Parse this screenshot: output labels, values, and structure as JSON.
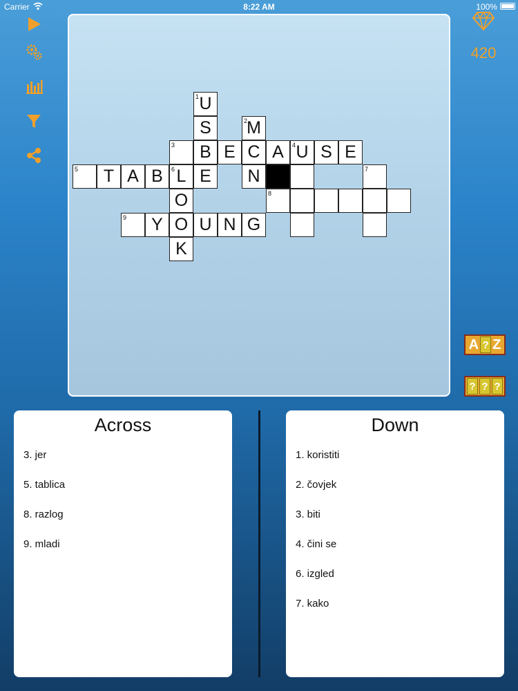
{
  "status_bar": {
    "carrier": "Carrier",
    "time": "8:22 AM",
    "battery": "100%"
  },
  "toolbar": {
    "items": [
      {
        "name": "play",
        "icon": "play-icon"
      },
      {
        "name": "settings",
        "icon": "gears-icon"
      },
      {
        "name": "statistics",
        "icon": "bar-chart-icon"
      },
      {
        "name": "filter",
        "icon": "filter-icon"
      },
      {
        "name": "share",
        "icon": "share-icon"
      }
    ],
    "accent_color": "#f0a02a"
  },
  "score": {
    "icon": "diamond-icon",
    "coins": "420"
  },
  "hints": {
    "reveal_letter": {
      "left": "A",
      "middle": "?",
      "right": "Z"
    },
    "reveal_word": {
      "marks": [
        "?",
        "?",
        "?"
      ]
    }
  },
  "grid": {
    "cells": [
      {
        "r": 0,
        "c": 5,
        "letter": "U",
        "num": "1"
      },
      {
        "r": 1,
        "c": 5,
        "letter": "S",
        "num": ""
      },
      {
        "r": 1,
        "c": 7,
        "letter": "M",
        "num": "2"
      },
      {
        "r": 2,
        "c": 4,
        "letter": "",
        "num": "3"
      },
      {
        "r": 2,
        "c": 5,
        "letter": "B",
        "num": ""
      },
      {
        "r": 2,
        "c": 6,
        "letter": "E",
        "num": ""
      },
      {
        "r": 2,
        "c": 7,
        "letter": "C",
        "num": ""
      },
      {
        "r": 2,
        "c": 8,
        "letter": "A",
        "num": ""
      },
      {
        "r": 2,
        "c": 9,
        "letter": "U",
        "num": "4"
      },
      {
        "r": 2,
        "c": 10,
        "letter": "S",
        "num": ""
      },
      {
        "r": 2,
        "c": 11,
        "letter": "E",
        "num": ""
      },
      {
        "r": 3,
        "c": 0,
        "letter": "",
        "num": "5"
      },
      {
        "r": 3,
        "c": 1,
        "letter": "T",
        "num": ""
      },
      {
        "r": 3,
        "c": 2,
        "letter": "A",
        "num": ""
      },
      {
        "r": 3,
        "c": 3,
        "letter": "B",
        "num": ""
      },
      {
        "r": 3,
        "c": 4,
        "letter": "L",
        "num": "6"
      },
      {
        "r": 3,
        "c": 5,
        "letter": "E",
        "num": ""
      },
      {
        "r": 3,
        "c": 7,
        "letter": "N",
        "num": ""
      },
      {
        "r": 3,
        "c": 8,
        "letter": "",
        "num": "",
        "black": true
      },
      {
        "r": 3,
        "c": 9,
        "letter": "",
        "num": ""
      },
      {
        "r": 3,
        "c": 12,
        "letter": "",
        "num": "7"
      },
      {
        "r": 4,
        "c": 4,
        "letter": "O",
        "num": ""
      },
      {
        "r": 4,
        "c": 8,
        "letter": "",
        "num": "8"
      },
      {
        "r": 4,
        "c": 9,
        "letter": "",
        "num": ""
      },
      {
        "r": 4,
        "c": 10,
        "letter": "",
        "num": ""
      },
      {
        "r": 4,
        "c": 11,
        "letter": "",
        "num": ""
      },
      {
        "r": 4,
        "c": 12,
        "letter": "",
        "num": ""
      },
      {
        "r": 4,
        "c": 13,
        "letter": "",
        "num": ""
      },
      {
        "r": 5,
        "c": 2,
        "letter": "",
        "num": "9"
      },
      {
        "r": 5,
        "c": 3,
        "letter": "Y",
        "num": ""
      },
      {
        "r": 5,
        "c": 4,
        "letter": "O",
        "num": ""
      },
      {
        "r": 5,
        "c": 5,
        "letter": "U",
        "num": ""
      },
      {
        "r": 5,
        "c": 6,
        "letter": "N",
        "num": ""
      },
      {
        "r": 5,
        "c": 7,
        "letter": "G",
        "num": ""
      },
      {
        "r": 5,
        "c": 9,
        "letter": "",
        "num": ""
      },
      {
        "r": 5,
        "c": 12,
        "letter": "",
        "num": ""
      },
      {
        "r": 6,
        "c": 4,
        "letter": "K",
        "num": ""
      }
    ]
  },
  "across": {
    "title": "Across",
    "clues": [
      "3. jer",
      "5. tablica",
      "8. razlog",
      "9. mladi"
    ]
  },
  "down": {
    "title": "Down",
    "clues": [
      "1. koristiti",
      "2. čovjek",
      "3. biti",
      "4. čini se",
      "6. izgled",
      "7. kako"
    ]
  }
}
